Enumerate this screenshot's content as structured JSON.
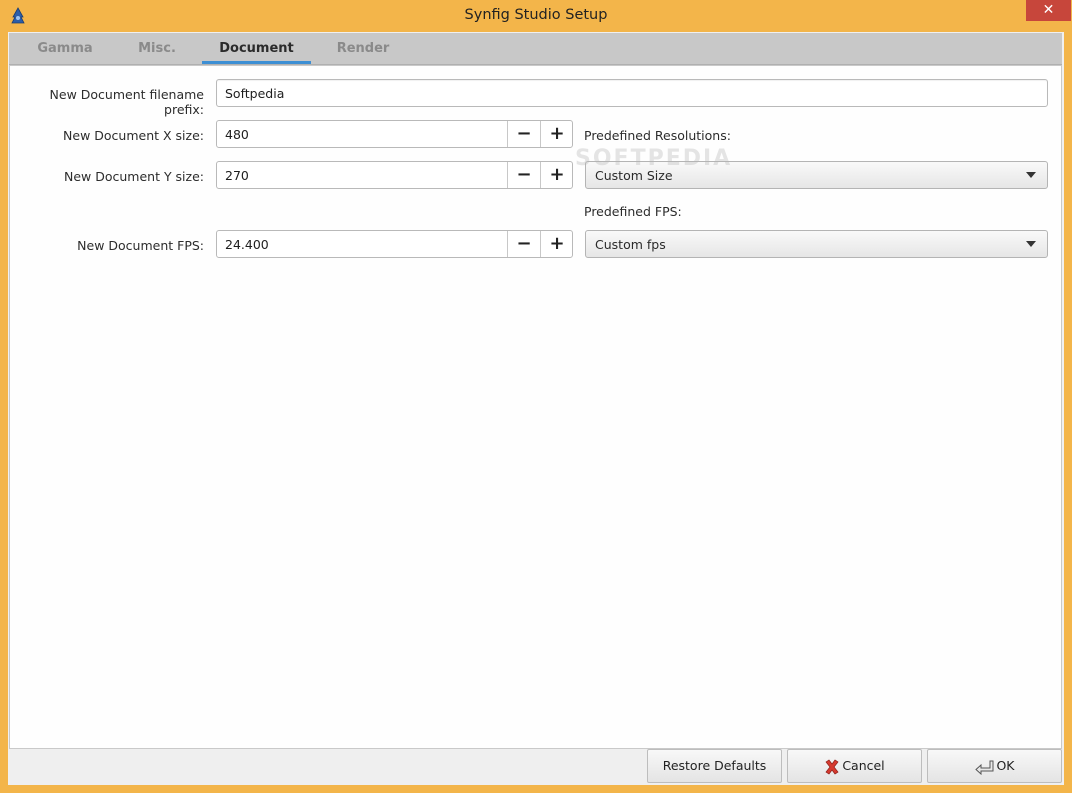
{
  "window": {
    "title": "Synfig Studio Setup",
    "close_glyph": "✕",
    "app_icon": "synfig-app-icon"
  },
  "tabs": [
    {
      "label": "Gamma",
      "active": false
    },
    {
      "label": "Misc.",
      "active": false
    },
    {
      "label": "Document",
      "active": true
    },
    {
      "label": "Render",
      "active": false
    }
  ],
  "document": {
    "prefix_label": "New Document filename prefix:",
    "prefix_value": "Softpedia",
    "x_label": "New Document X size:",
    "x_value": "480",
    "y_label": "New Document Y size:",
    "y_value": "270",
    "fps_label": "New Document FPS:",
    "fps_value": "24.400",
    "minus_glyph": "−",
    "plus_glyph": "+",
    "resolutions_label": "Predefined Resolutions:",
    "resolutions_value": "Custom Size",
    "fps_presets_label": "Predefined FPS:",
    "fps_presets_value": "Custom fps"
  },
  "watermark": "SOFTPEDIA",
  "buttons": {
    "restore": "Restore Defaults",
    "cancel": "Cancel",
    "ok": "OK"
  },
  "colors": {
    "frame": "#f3b54a",
    "tab_accent": "#3d8fd4",
    "close": "#c7463b"
  }
}
